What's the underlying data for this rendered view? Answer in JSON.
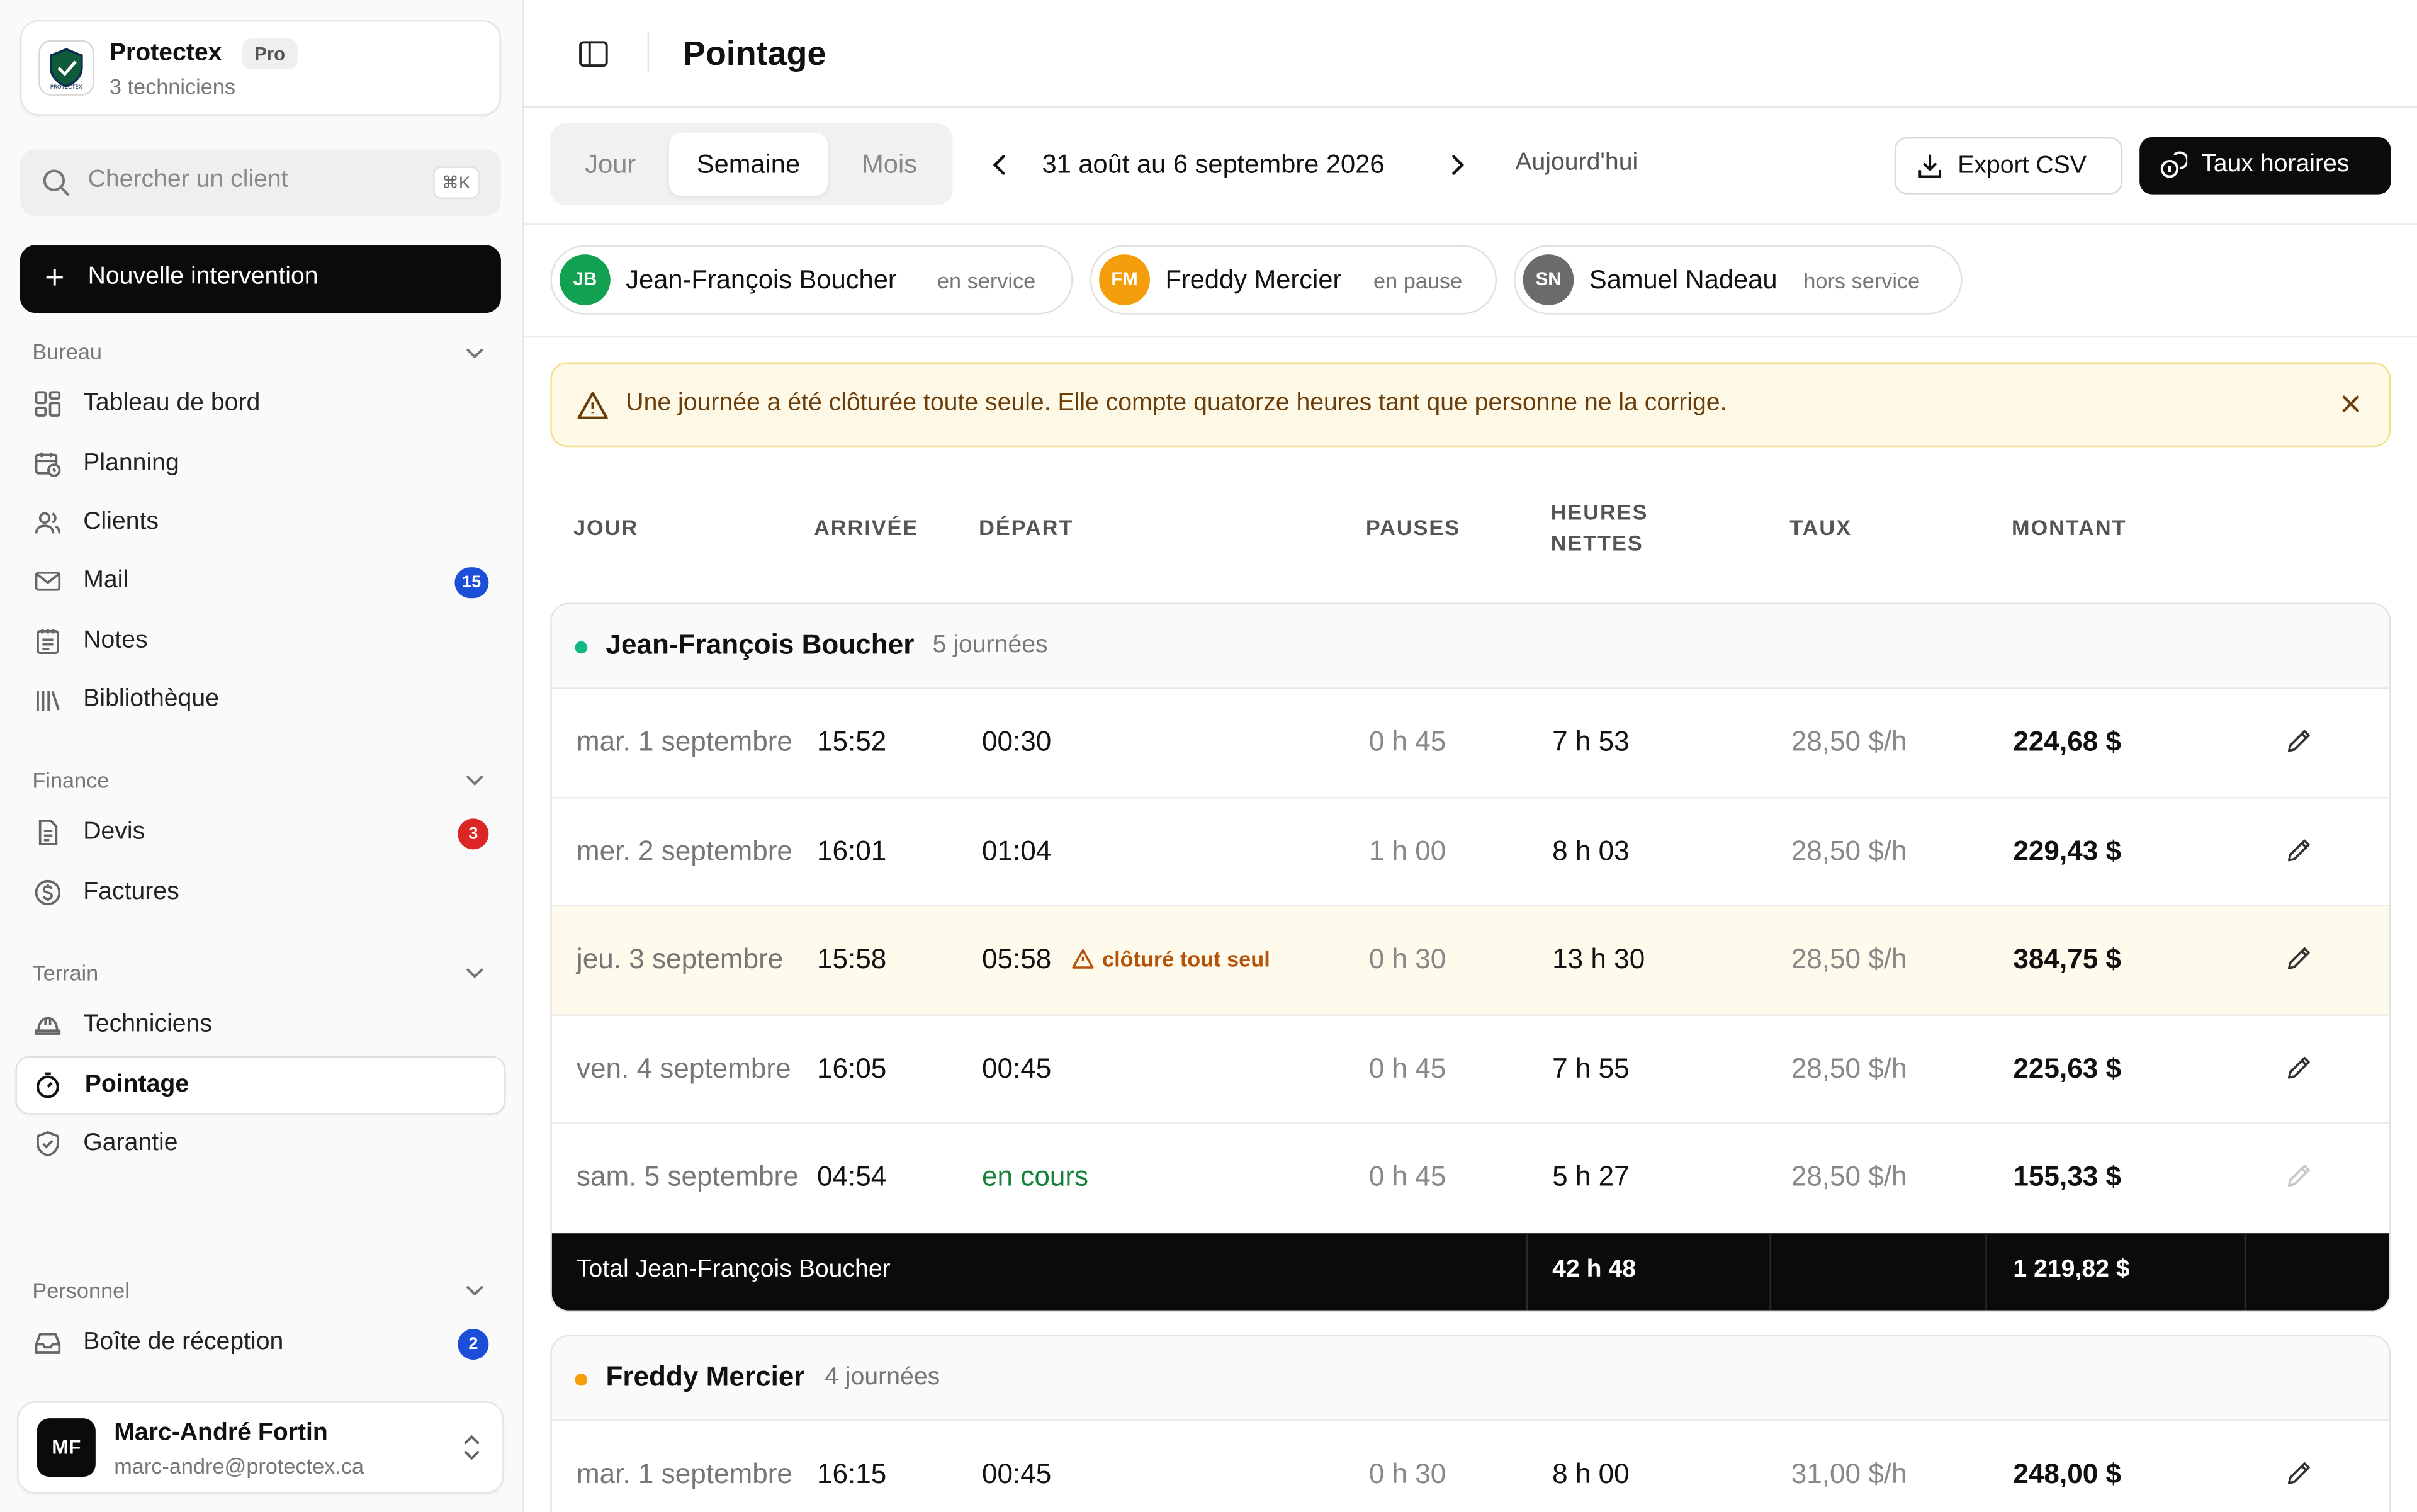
{
  "org": {
    "name": "Protectex",
    "plan_badge": "Pro",
    "subtitle": "3 techniciens",
    "logo_text": "PROTECTEX"
  },
  "search": {
    "placeholder": "Chercher un client",
    "shortcut": "⌘K"
  },
  "new_intervention_label": "Nouvelle intervention",
  "sidebar": {
    "sections": [
      {
        "label": "Bureau"
      },
      {
        "label": "Finance"
      },
      {
        "label": "Terrain"
      },
      {
        "label": "Personnel"
      }
    ],
    "items": [
      {
        "label": "Tableau de bord",
        "icon": "dashboard-icon"
      },
      {
        "label": "Planning",
        "icon": "calendar-clock-icon"
      },
      {
        "label": "Clients",
        "icon": "users-icon"
      },
      {
        "label": "Mail",
        "icon": "mail-icon",
        "badge": "15",
        "badge_color": "#1d4ed8"
      },
      {
        "label": "Notes",
        "icon": "notepad-icon"
      },
      {
        "label": "Bibliothèque",
        "icon": "library-icon"
      },
      {
        "label": "Devis",
        "icon": "document-icon",
        "badge": "3",
        "badge_color": "#dc2626"
      },
      {
        "label": "Factures",
        "icon": "dollar-circle-icon"
      },
      {
        "label": "Techniciens",
        "icon": "hard-hat-icon"
      },
      {
        "label": "Pointage",
        "icon": "stopwatch-icon",
        "active": true
      },
      {
        "label": "Garantie",
        "icon": "shield-check-icon"
      },
      {
        "label": "Boîte de réception",
        "icon": "inbox-icon",
        "badge": "2",
        "badge_color": "#1d4ed8"
      }
    ]
  },
  "user": {
    "initials": "MF",
    "name": "Marc-André Fortin",
    "email": "marc-andre@protectex.ca"
  },
  "page_title": "Pointage",
  "view_tabs": [
    {
      "label": "Jour",
      "selected": false
    },
    {
      "label": "Semaine",
      "selected": true
    },
    {
      "label": "Mois",
      "selected": false
    }
  ],
  "date_range": "31 août au 6 septembre 2026",
  "today_label": "Aujourd'hui",
  "export_label": "Export CSV",
  "rates_label": "Taux horaires",
  "technicians": [
    {
      "initials": "JB",
      "name": "Jean-François Boucher",
      "status": "en service",
      "color": "#12a150"
    },
    {
      "initials": "FM",
      "name": "Freddy Mercier",
      "status": "en pause",
      "color": "#f59e0b"
    },
    {
      "initials": "SN",
      "name": "Samuel Nadeau",
      "status": "hors service",
      "color": "#6b6b6b"
    }
  ],
  "alert_text": "Une journée a été clôturée toute seule. Elle compte quatorze heures tant que personne ne la corrige.",
  "columns": {
    "day": "JOUR",
    "arrival": "ARRIVÉE",
    "departure": "DÉPART",
    "breaks": "PAUSES",
    "net_hours_1": "HEURES",
    "net_hours_2": "NETTES",
    "rate": "TAUX",
    "amount": "MONTANT"
  },
  "groups": [
    {
      "name": "Jean-François Boucher",
      "count": "5 journées",
      "dot_color": "#12b886",
      "rows": [
        {
          "day": "mar. 1 septembre",
          "arrival": "15:52",
          "departure": "00:30",
          "breaks": "0 h 45",
          "net": "7 h 53",
          "rate": "28,50 $/h",
          "amount": "224,68 $"
        },
        {
          "day": "mer. 2 septembre",
          "arrival": "16:01",
          "departure": "01:04",
          "breaks": "1 h 00",
          "net": "8 h 03",
          "rate": "28,50 $/h",
          "amount": "229,43 $"
        },
        {
          "day": "jeu. 3 septembre",
          "arrival": "15:58",
          "departure": "05:58",
          "flag": "clôturé tout seul",
          "breaks": "0 h 30",
          "net": "13 h 30",
          "rate": "28,50 $/h",
          "amount": "384,75 $"
        },
        {
          "day": "ven. 4 septembre",
          "arrival": "16:05",
          "departure": "00:45",
          "breaks": "0 h 45",
          "net": "7 h 55",
          "rate": "28,50 $/h",
          "amount": "225,63 $"
        },
        {
          "day": "sam. 5 septembre",
          "arrival": "04:54",
          "departure": "en cours",
          "live": true,
          "breaks": "0 h 45",
          "net": "5 h 27",
          "rate": "28,50 $/h",
          "amount": "155,33 $"
        }
      ],
      "total": {
        "label": "Total Jean-François Boucher",
        "net": "42 h 48",
        "amount": "1 219,82 $"
      }
    },
    {
      "name": "Freddy Mercier",
      "count": "4 journées",
      "dot_color": "#f59e0b",
      "rows": [
        {
          "day": "mar. 1 septembre",
          "arrival": "16:15",
          "departure": "00:45",
          "breaks": "0 h 30",
          "net": "8 h 00",
          "rate": "31,00 $/h",
          "amount": "248,00 $"
        }
      ]
    }
  ]
}
